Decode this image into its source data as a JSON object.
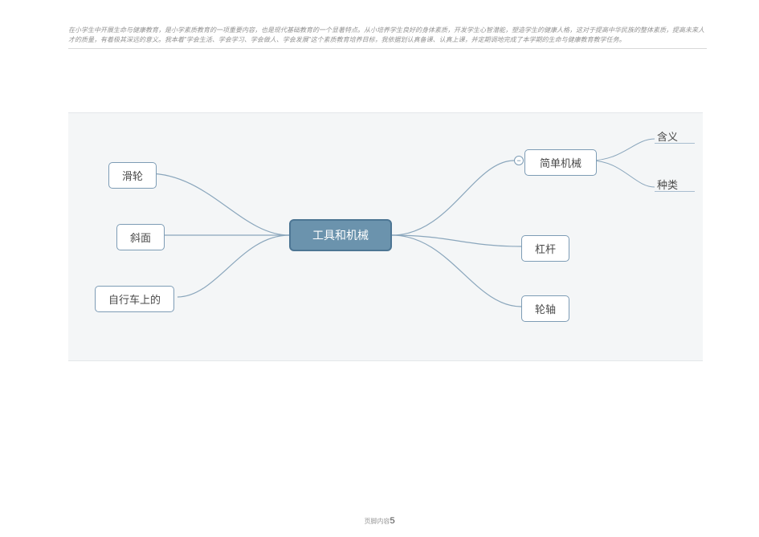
{
  "header": {
    "paragraph": "在小学生中开展生命与健康教育，是小学素质教育的一项重要内容，也是现代基础教育的一个显著特点。从小培养学生良好的身体素质，开发学生心智潜能，塑造学生的健康人格，这对于提高中华民族的整体素质，提高未来人才的质量，有着极其深远的意义。我本着\"学会生活、学会学习、学会做人、学会发展\"这个素质教育培养目标，我依据划认真备课、认真上课，并定期调地完成了本学期的生命与健康教育教学任务。"
  },
  "mindmap": {
    "center": {
      "label": "工具和机械"
    },
    "left_nodes": [
      {
        "label": "滑轮"
      },
      {
        "label": "斜面"
      },
      {
        "label": "自行车上的"
      }
    ],
    "right_nodes": [
      {
        "label": "简单机械",
        "expandable": true,
        "children": [
          {
            "label": "含义"
          },
          {
            "label": "种类"
          }
        ]
      },
      {
        "label": "杠杆"
      },
      {
        "label": "轮轴"
      }
    ],
    "collapse_symbol": "−"
  },
  "footer": {
    "label": "页脚内容",
    "page_number": "5"
  }
}
